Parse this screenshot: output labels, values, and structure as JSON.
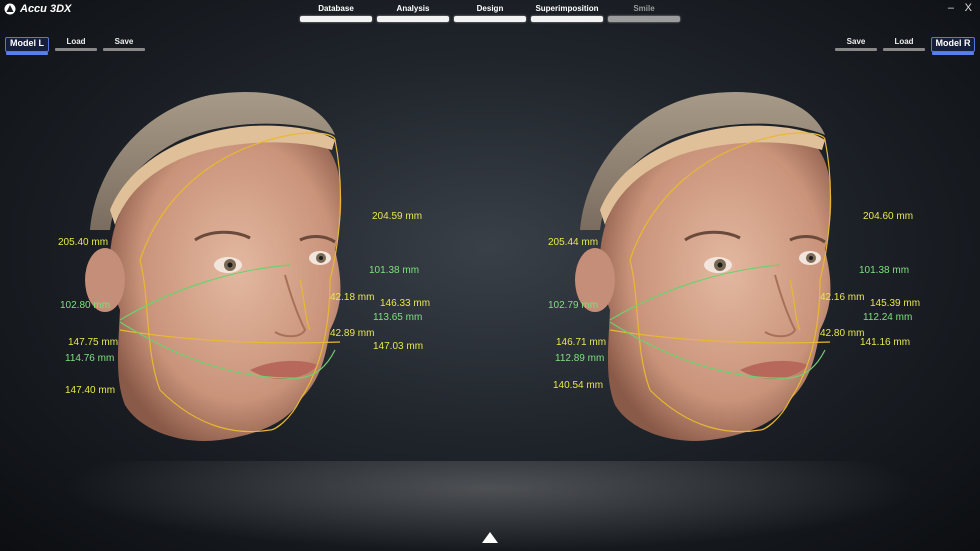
{
  "app": {
    "title": "Accu 3DX",
    "close_glyph": "X",
    "minimize_glyph": "–"
  },
  "nav": {
    "tabs": [
      {
        "label": "Database"
      },
      {
        "label": "Analysis"
      },
      {
        "label": "Design"
      },
      {
        "label": "Superimposition"
      },
      {
        "label": "Smile",
        "disabled": true
      }
    ]
  },
  "left_toolbar": {
    "model": "Model L",
    "load": "Load",
    "save": "Save"
  },
  "right_toolbar": {
    "save": "Save",
    "load": "Load",
    "model": "Model R"
  },
  "left_measurements": [
    "204.59 mm",
    "205.40 mm",
    "101.38 mm",
    "102.80 mm",
    "42.18 mm",
    "146.33 mm",
    "113.65 mm",
    "42.89 mm",
    "147.75 mm",
    "147.03 mm",
    "114.76 mm",
    "147.40 mm"
  ],
  "right_measurements": [
    "204.60 mm",
    "205.44 mm",
    "101.38 mm",
    "102.79 mm",
    "42.16 mm",
    "145.39 mm",
    "112.24 mm",
    "42.80 mm",
    "146.71 mm",
    "141.16 mm",
    "112.89 mm",
    "140.54 mm"
  ],
  "colors": {
    "yellow": "#e8e848",
    "green": "#7ee07e",
    "accent": "#5577dd"
  }
}
